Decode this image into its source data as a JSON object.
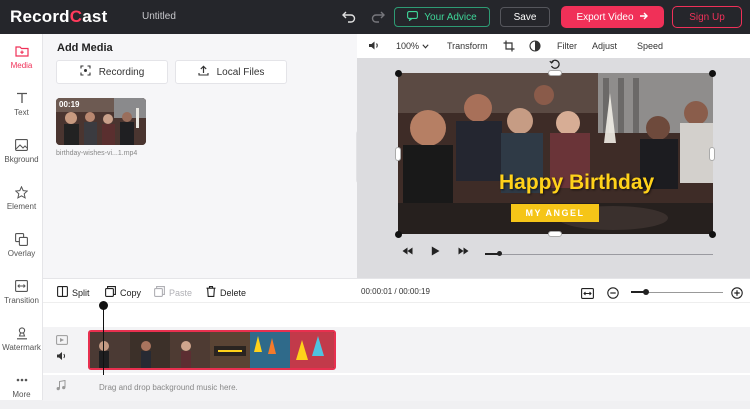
{
  "app": {
    "logo_prefix": "Record",
    "logo_glyph": "C",
    "logo_suffix": "ast",
    "document_title": "Untitled",
    "accent_color": "#f03058"
  },
  "topbar": {
    "undo_icon": "undo-icon",
    "redo_icon": "redo-icon",
    "advice_label": "Your Advice",
    "save_label": "Save",
    "export_label": "Export Video",
    "signup_label": "Sign Up"
  },
  "sidebar": {
    "items": [
      {
        "label": "Media",
        "icon": "folder-icon",
        "active": true
      },
      {
        "label": "Text",
        "icon": "text-icon"
      },
      {
        "label": "Bkground",
        "icon": "background-icon"
      },
      {
        "label": "Element",
        "icon": "star-icon"
      },
      {
        "label": "Overlay",
        "icon": "overlay-icon"
      },
      {
        "label": "Transition",
        "icon": "transition-icon"
      },
      {
        "label": "Watermark",
        "icon": "watermark-icon"
      },
      {
        "label": "More",
        "icon": "more-icon"
      }
    ]
  },
  "media": {
    "heading": "Add Media",
    "recording_label": "Recording",
    "local_files_label": "Local Files",
    "thumbnail": {
      "duration": "00:19",
      "filename": "birthday-wishes-vi...1.mp4"
    }
  },
  "preview": {
    "zoom": "100%",
    "tools": [
      "Transform",
      "Filter",
      "Adjust",
      "Speed"
    ],
    "overlay_title": "Happy Birthday",
    "overlay_subtitle": "MY ANGEL",
    "title_color": "#ffd21a",
    "subtitle_bg": "#f5c518"
  },
  "timeline": {
    "split_label": "Split",
    "copy_label": "Copy",
    "paste_label": "Paste",
    "delete_label": "Delete",
    "current_time": "00:00:01",
    "total_time": "00:00:19",
    "music_hint": "Drag and drop background music here."
  }
}
